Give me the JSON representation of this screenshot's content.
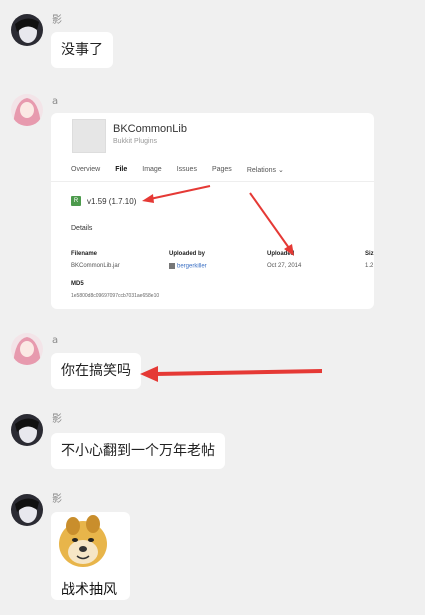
{
  "messages": [
    {
      "sender": "影",
      "text": "没事了"
    },
    {
      "sender": "a"
    },
    {
      "sender": "a",
      "text": "你在搞笑吗"
    },
    {
      "sender": "影",
      "text": "不小心翻到一个万年老帖"
    },
    {
      "sender": "影",
      "sticker_caption": "战术抽风"
    }
  ],
  "plugin_card": {
    "title": "BKCommonLib",
    "subtitle": "Bukkit Plugins",
    "tabs": [
      "Overview",
      "File",
      "Image",
      "Issues",
      "Pages",
      "Relations ⌄"
    ],
    "active_tab": "File",
    "release_badge": "R",
    "version": "v1.59 (1.7.10)",
    "details_label": "Details",
    "filename_label": "Filename",
    "filename_value": "BKCommonLib.jar",
    "uploaded_by_label": "Uploaded by",
    "uploaded_by_value": "bergerkiller",
    "uploaded_label": "Uploaded",
    "uploaded_value": "Oct 27, 2014",
    "size_label": "Siz",
    "size_value": "1.2",
    "md5_label": "MD5",
    "md5_value": "1e5800d8c09697097ccb7031ae658e10"
  },
  "colors": {
    "arrow": "#e53935",
    "background": "#f0f0f0",
    "bubble": "#ffffff",
    "badge": "#4c9a4c"
  }
}
